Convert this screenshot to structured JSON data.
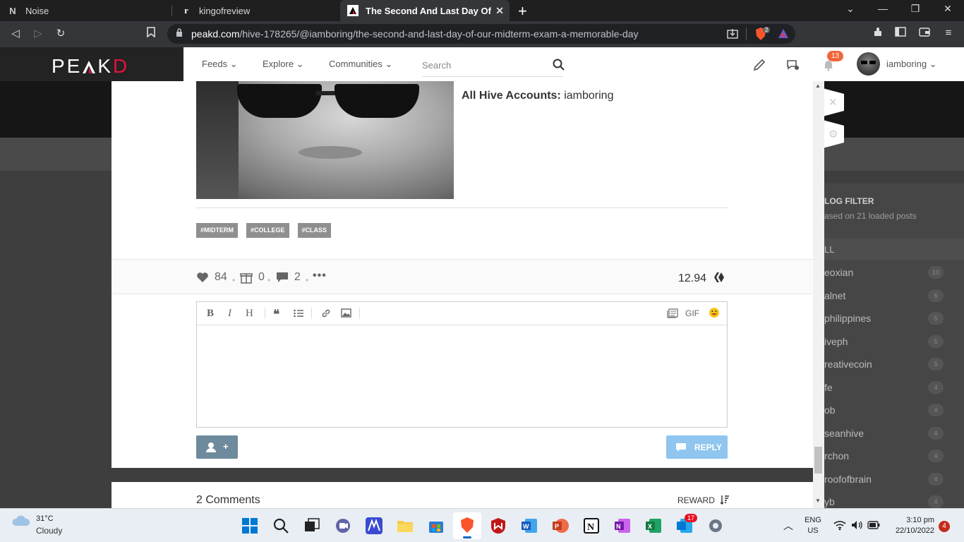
{
  "browser": {
    "tabs": [
      {
        "label": "Noise",
        "icon": "notion-icon"
      },
      {
        "label": "kingofreview",
        "icon": "site-icon"
      },
      {
        "label": "The Second And Last Day Of Our",
        "icon": "peakd-icon",
        "active": true
      }
    ],
    "url_host": "peakd.com",
    "url_path": "/hive-178265/@iamboring/the-second-and-last-day-of-our-midterm-exam-a-memorable-day",
    "brave_shield_count": "2"
  },
  "peakd": {
    "logo_main": "PE",
    "logo_mid": "K",
    "logo_end": "D",
    "nav": {
      "feeds": "Feeds",
      "explore": "Explore",
      "communities": "Communities"
    },
    "search_placeholder": "Search",
    "notifications": "13",
    "username": "iamboring"
  },
  "post": {
    "profile_label": "All Hive Accounts:",
    "profile_value": "iamboring",
    "tags": [
      "#MIDTERM",
      "#COLLEGE",
      "#CLASS"
    ],
    "votes": "84",
    "gifts": "0",
    "comments": "2",
    "payout": "12.94",
    "editor": {
      "bold": "B",
      "italic": "I",
      "heading": "H",
      "gif": "GIF"
    },
    "reply_label": "REPLY",
    "beneficiary_label": "+",
    "comments_count_label": "2 Comments",
    "sort_label": "REWARD"
  },
  "filter": {
    "title": "LOG FILTER",
    "subtitle": "ased on 21 loaded posts",
    "all": "LL",
    "items": [
      {
        "name": "eoxian",
        "count": "10"
      },
      {
        "name": "alnet",
        "count": "6"
      },
      {
        "name": "philippines",
        "count": "5"
      },
      {
        "name": "iveph",
        "count": "5"
      },
      {
        "name": "reativecoin",
        "count": "5"
      },
      {
        "name": "fe",
        "count": "4"
      },
      {
        "name": "ob",
        "count": "4"
      },
      {
        "name": "seanhive",
        "count": "4"
      },
      {
        "name": "rchon",
        "count": "4"
      },
      {
        "name": "roofofbrain",
        "count": "4"
      },
      {
        "name": "yb",
        "count": "4"
      }
    ]
  },
  "taskbar": {
    "temperature": "31°C",
    "condition": "Cloudy",
    "lang": "ENG",
    "region": "US",
    "time": "3:10 pm",
    "date": "22/10/2022",
    "notifications": "4",
    "onenote_badge": "17"
  }
}
